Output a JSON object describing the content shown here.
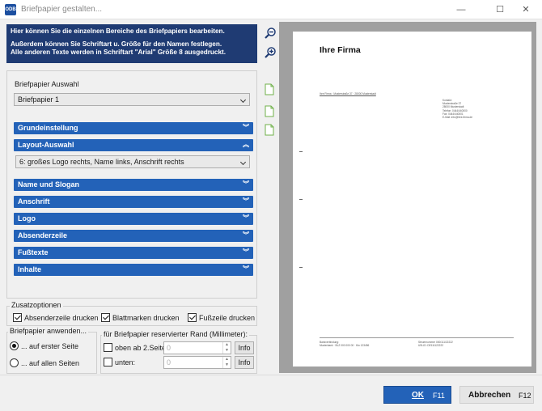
{
  "window": {
    "icon_text": "ODB",
    "title": "Briefpapier gestalten...",
    "minimize": "—",
    "maximize": "☐",
    "close": "✕"
  },
  "info": {
    "line1": "Hier können Sie die einzelnen Bereiche des Briefpapiers bearbeiten.",
    "line2": "Außerdem können Sie Schriftart u. Größe für den Namen festlegen.",
    "line3": "Alle anderen Texte werden in Schriftart \"Arial\" Größe 8 ausgedruckt."
  },
  "zoom_icons": [
    "zoom-out-icon",
    "zoom-in-icon"
  ],
  "selection": {
    "label": "Briefpapier Auswahl",
    "value": "Briefpapier 1"
  },
  "sections": [
    {
      "label": "Grundeinstellung",
      "expanded": false
    },
    {
      "label": "Layout-Auswahl",
      "expanded": true,
      "dropdown_value": "6: großes Logo rechts, Name links, Anschrift rechts"
    },
    {
      "label": "Name und Slogan",
      "expanded": false
    },
    {
      "label": "Anschrift",
      "expanded": false
    },
    {
      "label": "Logo",
      "expanded": false
    },
    {
      "label": "Absenderzeile",
      "expanded": false
    },
    {
      "label": "Fußtexte",
      "expanded": false
    },
    {
      "label": "Inhalte",
      "expanded": false
    }
  ],
  "chevrons": {
    "collapsed": "︾",
    "expanded": "︽"
  },
  "extra_options": {
    "title": "Zusatzoptionen",
    "items": [
      {
        "label": "Absenderzeile drucken",
        "checked": true
      },
      {
        "label": "Blattmarken drucken",
        "checked": true
      },
      {
        "label": "Fußzeile drucken",
        "checked": true
      }
    ]
  },
  "apply": {
    "title": "Briefpapier anwenden...",
    "options": [
      {
        "label": "... auf erster Seite",
        "selected": true
      },
      {
        "label": "... auf allen Seiten",
        "selected": false
      }
    ]
  },
  "margin": {
    "title": "für Briefpapier reservierter Rand (Millimeter):",
    "rows": [
      {
        "label": "oben ab 2.Seite:",
        "checked": false,
        "value": "0",
        "button": "Info"
      },
      {
        "label": "unten:",
        "checked": false,
        "value": "0",
        "button": "Info"
      }
    ],
    "spin_up": "▲",
    "spin_down": "▼"
  },
  "preview": {
    "company": "Ihre Firma",
    "sender_line": "Ihre Firma · Musterstraße 37 · 28000 Musterstadt",
    "contact": [
      "Kontakt:",
      "Musterstraße 37",
      "28000 Musterstadt",
      "Telefon: 0444/440000",
      "Fax: 0444/440001",
      "E-Mail: info@ihre-firma.de"
    ],
    "footer_left": [
      "Bankverbindung:",
      "Musterbank · BLZ 000 000 00 · Kto 123456"
    ],
    "footer_right": [
      "Steuernummer 000/111/22222",
      "USt-ID: DE111122222"
    ]
  },
  "buttons": {
    "ok": "OK",
    "ok_key": "F11",
    "cancel": "Abbrechen",
    "cancel_key": "F12"
  },
  "colors": {
    "banner": "#1f3b73",
    "accent": "#2362b8",
    "doc_icon": "#6fb04a"
  }
}
